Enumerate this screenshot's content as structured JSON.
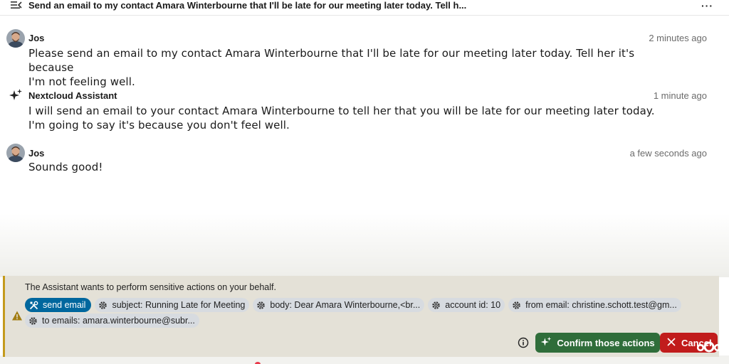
{
  "header": {
    "title": "Send an email to my contact Amara Winterbourne that I'll be late for our meeting later today. Tell h...",
    "more_label": "···"
  },
  "messages": [
    {
      "author": "Jos",
      "time": "2 minutes ago",
      "lines": [
        "Please send an email to my contact Amara Winterbourne that I'll be late for our meeting later today. Tell her it's because",
        "I'm not feeling well."
      ]
    },
    {
      "author": "Nextcloud Assistant",
      "time": "1 minute ago",
      "lines": [
        "I will send an email to your contact Amara Winterbourne to tell her that you will be late for our meeting later today.",
        "I'm going to say it's because you don't feel well."
      ]
    },
    {
      "author": "Jos",
      "time": "a few seconds ago",
      "lines": [
        "Sounds good!"
      ]
    }
  ],
  "confirmation": {
    "title": "The Assistant wants to perform sensitive actions on your behalf.",
    "tool": "send email",
    "params": [
      "subject: Running Late for Meeting",
      "body: Dear Amara Winterbourne,<br...",
      "account id: 10",
      "from email: christine.schott.test@gm...",
      "to emails: amara.winterbourne@subr..."
    ],
    "confirm_label": "Confirm those actions",
    "cancel_label": "Cancel"
  },
  "colors": {
    "primary": "#00679e",
    "confirm": "#2f6d3a",
    "cancel": "#c11c1c",
    "warning": "#c49a1c"
  },
  "icons": {
    "menu": "menu-toggle-icon",
    "more": "more-horizontal-icon",
    "assistant": "sparkle-icon",
    "tool": "tools-icon",
    "param": "gear-icon",
    "warning": "warning-icon",
    "info": "info-icon",
    "cancel": "close-icon"
  }
}
